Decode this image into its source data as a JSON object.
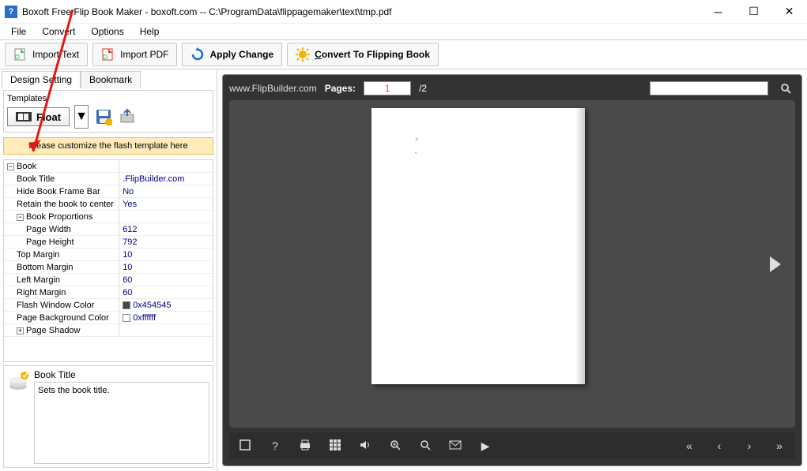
{
  "window": {
    "title": "Boxoft Free Flip Book Maker - boxoft.com -- C:\\ProgramData\\flippagemaker\\text\\tmp.pdf"
  },
  "menu": {
    "file": "File",
    "convert": "Convert",
    "options": "Options",
    "help": "Help"
  },
  "toolbar": {
    "import_text": "Import Text",
    "import_pdf": "Import PDF",
    "apply_change": "Apply Change",
    "convert_book": "Convert To Flipping Book"
  },
  "tabs": {
    "design": "Design Setting",
    "bookmark": "Bookmark"
  },
  "templates": {
    "label": "Templates",
    "float": "Float",
    "customize": "Please customize the flash template here"
  },
  "props": {
    "cat_book": "Book",
    "book_title_k": "Book Title",
    "book_title_v": ".FlipBuilder.com",
    "hide_bar_k": "Hide Book Frame Bar",
    "hide_bar_v": "No",
    "retain_k": "Retain the book to center",
    "retain_v": "Yes",
    "cat_prop": "Book Proportions",
    "pw_k": "Page Width",
    "pw_v": "612",
    "ph_k": "Page Height",
    "ph_v": "792",
    "tm_k": "Top Margin",
    "tm_v": "10",
    "bm_k": "Bottom Margin",
    "bm_v": "10",
    "lm_k": "Left Margin",
    "lm_v": "60",
    "rm_k": "Right Margin",
    "rm_v": "60",
    "fw_k": "Flash Window Color",
    "fw_v": "0x454545",
    "fw_c": "#454545",
    "pb_k": "Page Background Color",
    "pb_v": "0xffffff",
    "pb_c": "#ffffff",
    "cat_shadow": "Page Shadow"
  },
  "help": {
    "title": "Book Title",
    "desc": "Sets the book title."
  },
  "preview": {
    "url": "www.FlipBuilder.com",
    "pages_label": "Pages:",
    "current_page": "1",
    "total": "/2"
  }
}
